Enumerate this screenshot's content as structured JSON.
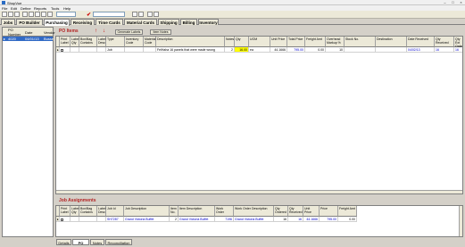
{
  "window": {
    "title": "ShopVue"
  },
  "menu": [
    "File",
    "Edit",
    "Define",
    "Reports",
    "Tools",
    "Help"
  ],
  "main_tabs": [
    {
      "label": "Jobs",
      "active": false
    },
    {
      "label": "PO Builder",
      "active": false
    },
    {
      "label": "Purchasing",
      "active": true
    },
    {
      "label": "Receiving",
      "active": false
    },
    {
      "label": "Time Cards",
      "active": false
    },
    {
      "label": "Material Cards",
      "active": false
    },
    {
      "label": "Shipping",
      "active": false
    },
    {
      "label": "Billing",
      "active": false
    },
    {
      "label": "Inventory",
      "active": false
    }
  ],
  "left_list": {
    "headers": [
      "PO Number",
      "Date",
      "Vendor"
    ],
    "row": {
      "po": "4020",
      "date": "04/01/13",
      "vendor": "Busse"
    }
  },
  "po_items": {
    "title": "PO Items",
    "buttons": {
      "generate": "Generate Labels",
      "item_notes": "Item Notes"
    },
    "headers": [
      "Print Label",
      "Label Qty",
      "Box/Bag Contains",
      "Label Desc",
      "Type",
      "Inventory Code",
      "Material Code",
      "Description",
      "Notes",
      "Qty",
      "UOM",
      "Unit Price",
      "Total Price",
      "Freight Amt",
      "Overhead Markup %",
      "Stock No.",
      "Destination",
      "Date Received",
      "Qty Received",
      "Qty Ext Orderd"
    ],
    "row": {
      "type": "Job",
      "description": "FelHaha 16 panels that were made wrong",
      "notes": "2",
      "qty": "16.00",
      "uom": "ea",
      "unit_price": "44.1666",
      "total_price": "795.00",
      "freight": "0.00",
      "overhead": "10",
      "date_received": "04/02/13",
      "qty_received": "16",
      "qty_ext": "16"
    }
  },
  "job_assignments": {
    "title": "Job Assignments",
    "headers": [
      "Print Label",
      "Label Qty",
      "Box/Bag Contains",
      "Label Desc",
      "Job Id",
      "Job Description",
      "Item No.",
      "Item Description",
      "Work Order",
      "Work Order Description",
      "Qty Ordered",
      "Qty Received",
      "Unit Price",
      "Price",
      "Freight Amt"
    ],
    "row": {
      "job_id": "SH7287",
      "job_desc": "Grand Victoria Buffet",
      "item_no": "2",
      "item_desc": "Grand Victoria Buffet",
      "work_order": "7196",
      "wo_desc": "Grand Victoria Buffet",
      "qty_ordered": "16",
      "qty_received": "16",
      "unit_price": "44.1666",
      "price": "795.00",
      "freight": "0.00"
    }
  },
  "bottom_tabs": [
    {
      "label": "Details",
      "active": false
    },
    {
      "label": "PO Items",
      "active": true
    },
    {
      "label": "Notes",
      "active": false
    },
    {
      "label": "Reconciliation",
      "active": false
    }
  ],
  "colors": {
    "accent": "#316ac5",
    "section_title": "#b22222",
    "link_values": "#0000cc",
    "highlight": "#ffff00"
  }
}
